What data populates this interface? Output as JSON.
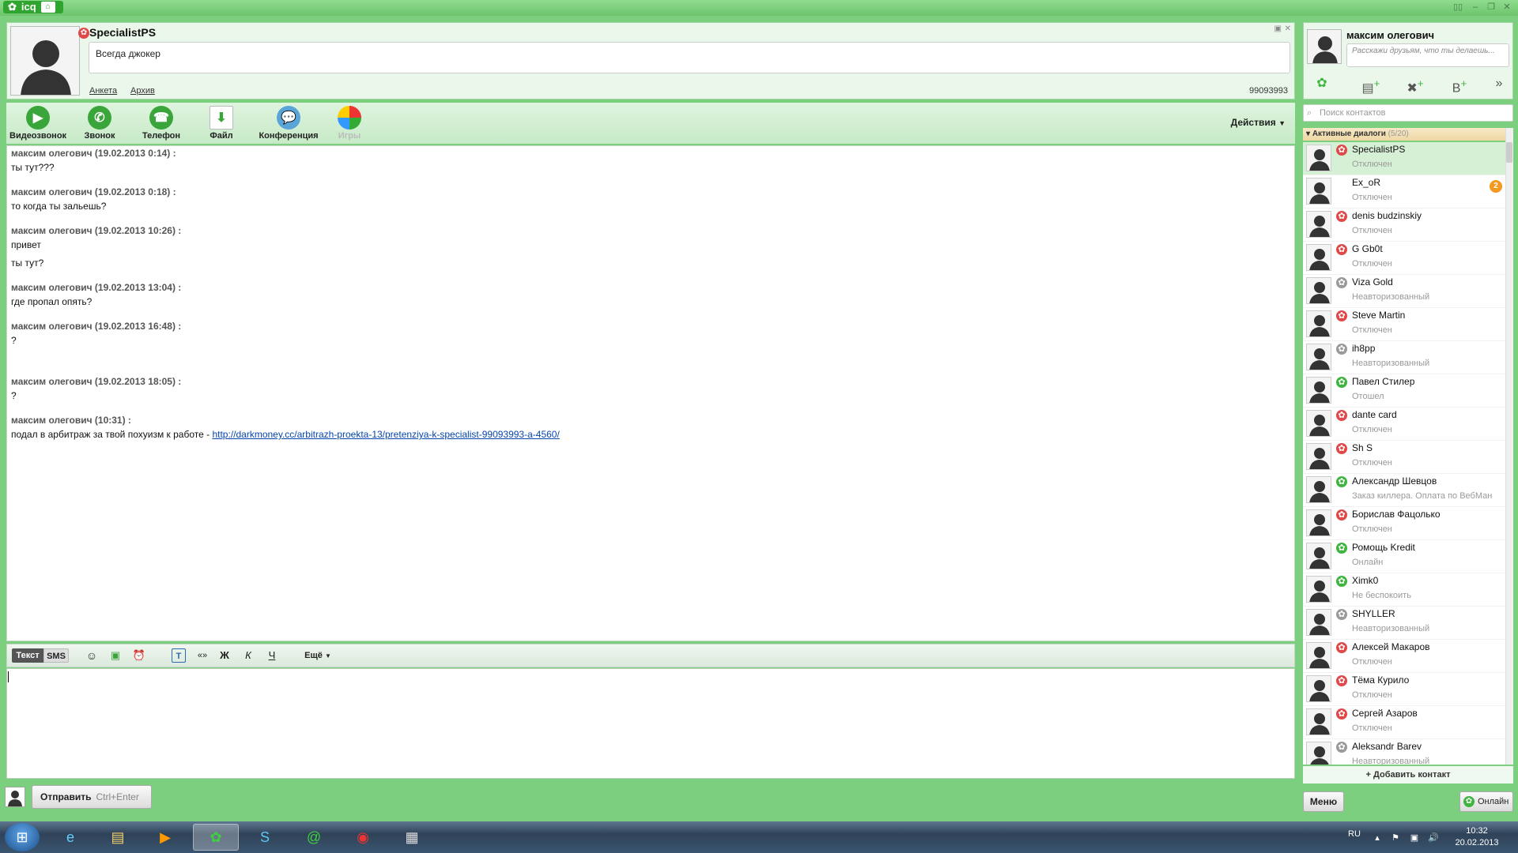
{
  "app": {
    "name": "icq"
  },
  "header": {
    "contact_name": "SpecialistPS",
    "status_message": "Всегда джокер",
    "links": [
      "Анкета",
      "Архив"
    ],
    "uin": "99093993"
  },
  "toolbar": {
    "buttons": [
      {
        "label": "Видеозвонок",
        "icon": "video-camera-icon"
      },
      {
        "label": "Звонок",
        "icon": "phone-handset-icon"
      },
      {
        "label": "Телефон",
        "icon": "telephone-icon"
      },
      {
        "label": "Файл",
        "icon": "file-download-icon"
      },
      {
        "label": "Конференция",
        "icon": "conference-bubble-icon"
      },
      {
        "label": "Игры",
        "icon": "games-globe-icon"
      }
    ],
    "actions_label": "Действия"
  },
  "messages": [
    {
      "who": "максим олегович (19.02.2013 0:14) :",
      "lines": [
        "ты тут???"
      ]
    },
    {
      "who": "максим олегович (19.02.2013 0:18) :",
      "lines": [
        "то когда ты зальешь?"
      ]
    },
    {
      "who": "максим олегович (19.02.2013 10:26) :",
      "lines": [
        "привет",
        "ты тут?"
      ]
    },
    {
      "who": "максим олегович (19.02.2013 13:04) :",
      "lines": [
        "где пропал опять?"
      ]
    },
    {
      "who": "максим олегович (19.02.2013 16:48) :",
      "lines": [
        "?"
      ]
    },
    {
      "who": "максим олегович (19.02.2013 18:05) :",
      "lines": [
        "?"
      ]
    },
    {
      "who": "максим олегович (10:31) :",
      "lines": [
        "подал в арбитраж за твой похуизм к работе - "
      ],
      "link": "http://darkmoney.cc/arbitrazh-proekta-13/pretenziya-k-specialist-99093993-a-4560/"
    }
  ],
  "format_bar": {
    "tab_text": "Текст",
    "tab_sms": "SMS",
    "quote": "«»",
    "bold": "Ж",
    "italic": "К",
    "underline": "Ч",
    "more": "Ещё"
  },
  "send": {
    "label": "Отправить",
    "shortcut": "Ctrl+Enter"
  },
  "profile": {
    "my_name": "максим олегович",
    "status_placeholder": "Расскажи друзьям, что ты делаешь..."
  },
  "search": {
    "placeholder": "Поиск контактов"
  },
  "group": {
    "title": "Активные диалоги",
    "count": "(5/20)"
  },
  "contacts": [
    {
      "name": "SpecialistPS",
      "status": "Отключен",
      "state": "offline",
      "selected": true
    },
    {
      "name": "Ex_oR",
      "status": "Отключен",
      "state": "none",
      "badge": "2"
    },
    {
      "name": "denis budzinskiy",
      "status": "Отключен",
      "state": "offline"
    },
    {
      "name": "G Gb0t",
      "status": "Отключен",
      "state": "offline"
    },
    {
      "name": "Viza Gold",
      "status": "Неавторизованный",
      "state": "unauth"
    },
    {
      "name": "Steve Martin",
      "status": "Отключен",
      "state": "offline"
    },
    {
      "name": "ih8pp",
      "status": "Неавторизованный",
      "state": "unauth"
    },
    {
      "name": "Павел Стилер",
      "status": "Отошел",
      "state": "away"
    },
    {
      "name": "dante card",
      "status": "Отключен",
      "state": "offline"
    },
    {
      "name": "Sh S",
      "status": "Отключен",
      "state": "offline"
    },
    {
      "name": "Александр Шевцов",
      "status": "Заказ киллера. Оплата по ВебМан",
      "state": "online"
    },
    {
      "name": "Борислав Фацолько",
      "status": "Отключен",
      "state": "offline"
    },
    {
      "name": "Ромощь Kredit",
      "status": "Онлайн",
      "state": "online"
    },
    {
      "name": "Ximk0",
      "status": "Не беспокоить",
      "state": "dnd"
    },
    {
      "name": "SHYLLER",
      "status": "Неавторизованный",
      "state": "unauth"
    },
    {
      "name": "Алексей Макаров",
      "status": "Отключен",
      "state": "offline"
    },
    {
      "name": "Тёма Курило",
      "status": "Отключен",
      "state": "offline"
    },
    {
      "name": "Сергей Азаров",
      "status": "Отключен",
      "state": "offline"
    },
    {
      "name": "Aleksandr Barev",
      "status": "Неавторизованный",
      "state": "unauth"
    }
  ],
  "add_contact": "+ Добавить контакт",
  "bottom": {
    "menu": "Меню",
    "online": "Онлайн"
  },
  "taskbar": {
    "lang": "RU",
    "time": "10:32",
    "date": "20.02.2013"
  },
  "colors": {
    "offline": "#e0494a",
    "online": "#3fb43f",
    "away": "#3fb43f",
    "dnd": "#3fb43f",
    "unauth": "#9a9a9a",
    "accent": "#7ccf7e"
  }
}
